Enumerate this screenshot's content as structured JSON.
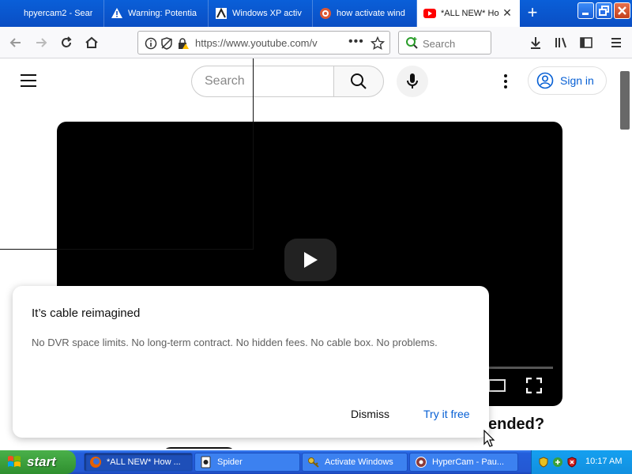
{
  "browser": {
    "tabs": [
      {
        "title": "hpyercam2 - Sear",
        "icon": "search-icon"
      },
      {
        "title": "Warning: Potentia",
        "icon": "warning-icon"
      },
      {
        "title": "Windows XP activ",
        "icon": "site-icon"
      },
      {
        "title": "how activate wind",
        "icon": "duckduckgo-icon"
      },
      {
        "title": "*ALL NEW* Ho",
        "icon": "youtube-icon",
        "active": true
      }
    ],
    "url": "https://www.youtube.com/v",
    "search_placeholder": "Search"
  },
  "youtube": {
    "search_placeholder": "Search",
    "sign_in_label": "Sign in",
    "title_fragment": "ended?",
    "accent_color": "#065fd4"
  },
  "popup": {
    "title": "It’s cable reimagined",
    "body": "No DVR space limits. No long-term contract. No hidden fees. No cable box. No problems.",
    "dismiss_label": "Dismiss",
    "try_label": "Try it free"
  },
  "taskbar": {
    "start_label": "start",
    "tasks": [
      {
        "label": "*ALL NEW* How ...",
        "active": true
      },
      {
        "label": "Spider",
        "active": false
      },
      {
        "label": "Activate Windows",
        "active": false
      },
      {
        "label": "HyperCam - Pau...",
        "active": false
      }
    ],
    "clock": "10:17 AM"
  }
}
